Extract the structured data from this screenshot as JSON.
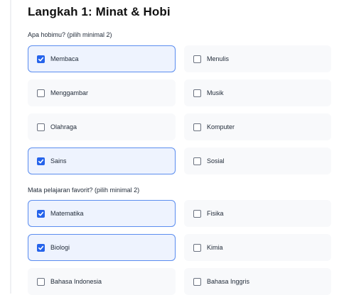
{
  "title": "Langkah 1: Minat & Hobi",
  "hobbies": {
    "question": "Apa hobimu? (pilih minimal 2)",
    "options": [
      {
        "label": "Membaca",
        "checked": true
      },
      {
        "label": "Menulis",
        "checked": false
      },
      {
        "label": "Menggambar",
        "checked": false
      },
      {
        "label": "Musik",
        "checked": false
      },
      {
        "label": "Olahraga",
        "checked": false
      },
      {
        "label": "Komputer",
        "checked": false
      },
      {
        "label": "Sains",
        "checked": true
      },
      {
        "label": "Sosial",
        "checked": false
      }
    ]
  },
  "subjects": {
    "question": "Mata pelajaran favorit? (pilih minimal 2)",
    "options": [
      {
        "label": "Matematika",
        "checked": true
      },
      {
        "label": "Fisika",
        "checked": false
      },
      {
        "label": "Biologi",
        "checked": true
      },
      {
        "label": "Kimia",
        "checked": false
      },
      {
        "label": "Bahasa Indonesia",
        "checked": false
      },
      {
        "label": "Bahasa Inggris",
        "checked": false
      }
    ]
  },
  "colors": {
    "accent": "#2563eb",
    "selected_border": "#5b8def",
    "selected_bg": "#eef3fe",
    "option_bg": "#f8f9fb"
  },
  "icons": {
    "checkbox_checked": "checkmark-icon"
  }
}
